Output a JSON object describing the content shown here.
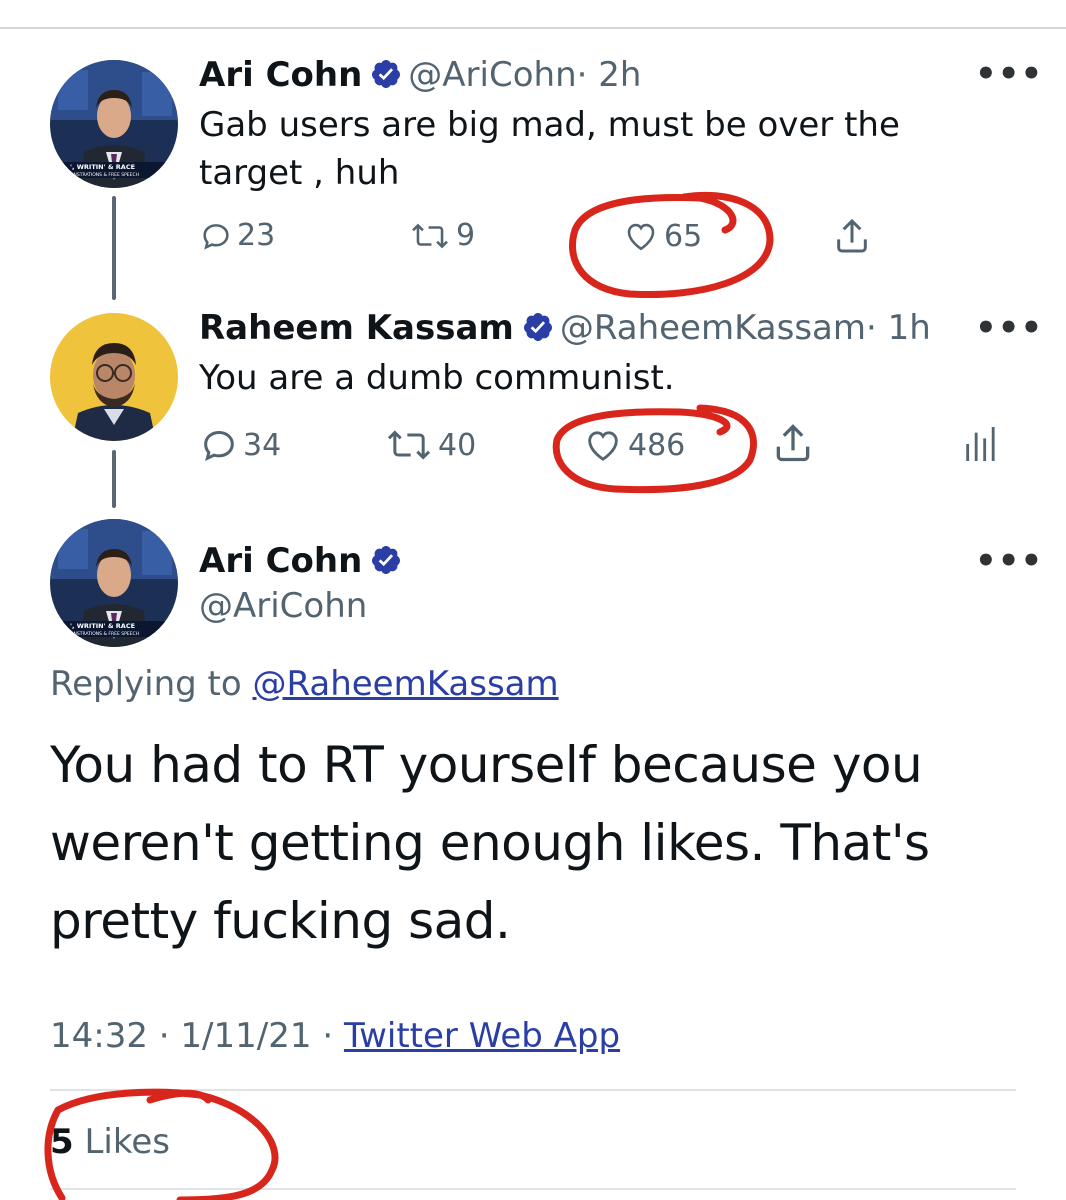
{
  "tweets": [
    {
      "name": "Ari Cohn",
      "handle": "@AriCohn",
      "time": "· 2h",
      "text": "Gab users are big mad, must be over the target , huh",
      "replies": "23",
      "retweets": "9",
      "likes": "65",
      "more": "•••"
    },
    {
      "name": "Raheem Kassam",
      "handle": "@RaheemKassam",
      "time": "· 1h",
      "text": "You are a dumb communist.",
      "replies": "34",
      "retweets": "40",
      "likes": "486",
      "more": "•••"
    }
  ],
  "main_tweet": {
    "name": "Ari Cohn",
    "handle": "@AriCohn",
    "more": "•••",
    "replying_prefix": "Replying to",
    "replying_to": "@RaheemKassam",
    "text": "You had to RT yourself because you weren't getting enough likes. That's pretty fucking sad.",
    "time": "14:32",
    "date": "1/11/21",
    "source": "Twitter Web App",
    "sep": "·",
    "likes_count": "5",
    "likes_label": "Likes"
  },
  "avatar_caption_line1": "', WRITIN' & RACE",
  "avatar_caption_line2": "ONSTRATIONS & FREE SPEECH",
  "colors": {
    "verified": "#2b3ea6",
    "annotation": "#d9261c",
    "text": "#0f1419",
    "muted": "#536471",
    "link": "#2b3ea6",
    "raheem_avatar_bg": "#f0c33c"
  },
  "icons": [
    "reply-icon",
    "retweet-icon",
    "heart-icon",
    "share-icon",
    "analytics-icon",
    "verified-icon",
    "more-icon"
  ]
}
